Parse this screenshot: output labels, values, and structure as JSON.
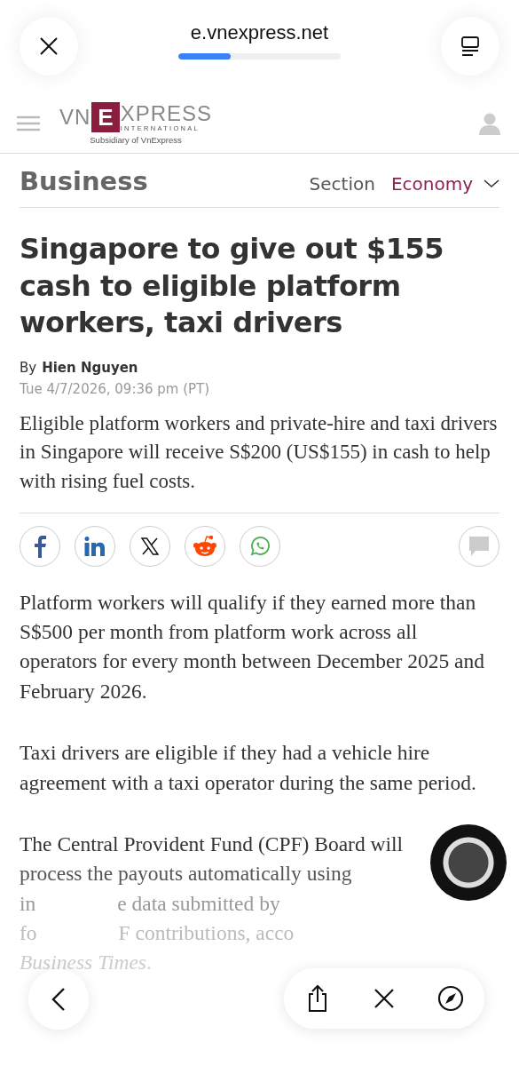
{
  "browser": {
    "url": "e.vnexpress.net",
    "progress": {
      "level": 0.32
    }
  },
  "logo": {
    "left": "VN",
    "boxed": "E",
    "right": "XPRESS",
    "sub": "INTERNATIONAL",
    "tagline": "Subsidiary of VnExpress"
  },
  "section_bar": {
    "category": "Business",
    "section_label": "Section",
    "section": "Economy"
  },
  "article": {
    "headline": "Singapore to give out $155 cash to eligible platform workers, taxi drivers",
    "byline_prefix": "By",
    "author": "Hien Nguyen",
    "date": "Tue 4/7/2026, 09:36 pm (PT)",
    "lead": "Eligible platform workers and private-hire and taxi drivers in Singapore will receive S$200 (US$155) in cash to help with rising fuel costs.",
    "share": [
      {
        "kind": "facebook"
      },
      {
        "kind": "linkedin"
      },
      {
        "kind": "x"
      },
      {
        "kind": "reddit"
      },
      {
        "kind": "whatsapp"
      }
    ],
    "paragraphs": [
      "Platform workers will qualify if they earned more than S$500 per month from platform work across all operators for every month between December 2025 and February 2026.",
      "Taxi drivers are eligible if they had a vehicle hire agreement with a taxi operator during the same period."
    ],
    "last_lines": [
      {
        "segments": [
          "The Central Provident Fund (CPF) Board will"
        ]
      },
      {
        "segments": [
          "process the payouts automatically using"
        ]
      },
      {
        "segments": [
          "in",
          "e data submitted by"
        ]
      },
      {
        "segments": [
          "fo",
          "F contributions, acco"
        ]
      },
      {
        "segments": [
          "*Business Times*."
        ]
      }
    ]
  }
}
